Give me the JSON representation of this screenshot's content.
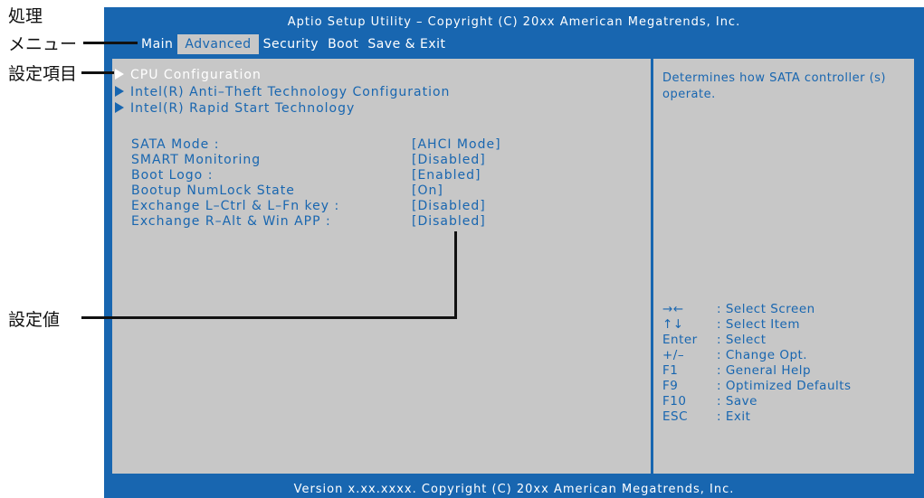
{
  "annotations": {
    "menu_top": "処理",
    "menu_bottom": "メニュー",
    "items": "設定項目",
    "values": "設定値"
  },
  "bios": {
    "title": "Aptio Setup Utility – Copyright (C) 20xx American Megatrends, Inc.",
    "menu": [
      "Main",
      "Advanced",
      "Security",
      "Boot",
      "Save & Exit"
    ],
    "active_menu": "Advanced",
    "submenus": [
      "CPU Configuration",
      "Intel(R) Anti–Theft Technology Configuration",
      "Intel(R) Rapid Start Technology"
    ],
    "settings": [
      {
        "label": "SATA Mode :",
        "value": "[AHCI Mode]"
      },
      {
        "label": "SMART Monitoring",
        "value": "[Disabled]"
      },
      {
        "label": "Boot Logo :",
        "value": "[Enabled]"
      },
      {
        "label": "Bootup NumLock State",
        "value": "[On]"
      },
      {
        "label": "Exchange L–Ctrl & L–Fn key :",
        "value": "[Disabled]"
      },
      {
        "label": "Exchange R–Alt & Win APP :",
        "value": "[Disabled]"
      }
    ],
    "help": "Determines how SATA controller (s) operate.",
    "keys": [
      {
        "key": "→←",
        "desc": ": Select Screen"
      },
      {
        "key": "↑↓",
        "desc": ": Select Item"
      },
      {
        "key": "Enter",
        "desc": ": Select"
      },
      {
        "key": "+/–",
        "desc": ": Change Opt."
      },
      {
        "key": "F1",
        "desc": ": General Help"
      },
      {
        "key": "F9",
        "desc": ": Optimized Defaults"
      },
      {
        "key": "F10",
        "desc": ": Save"
      },
      {
        "key": "ESC",
        "desc": ": Exit"
      }
    ],
    "footer": "Version x.xx.xxxx. Copyright (C) 20xx American Megatrends, Inc.",
    "colors": {
      "frame": "#1866b0",
      "panel": "#c7c7c7",
      "text": "#1866b0",
      "highlight": "#ffffff"
    }
  }
}
